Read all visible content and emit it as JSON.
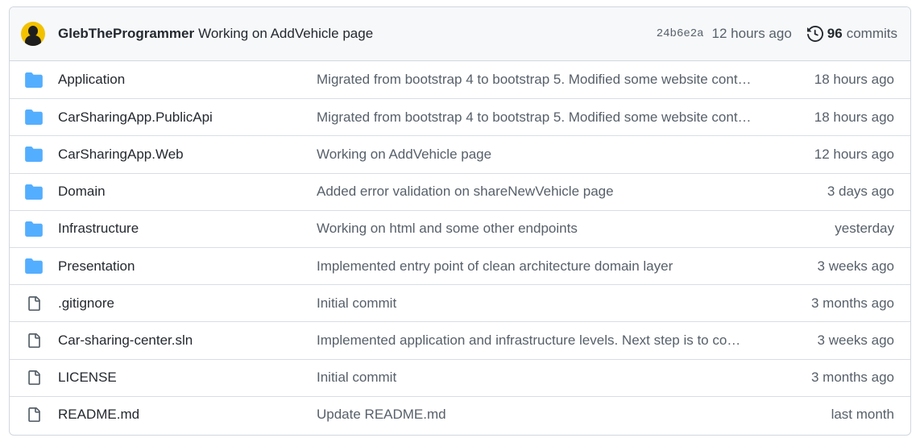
{
  "latest_commit": {
    "author": "GlebTheProgrammer",
    "message": "Working on AddVehicle page",
    "sha": "24b6e2a",
    "time": "12 hours ago",
    "commit_count": "96",
    "commits_label": "commits"
  },
  "files": [
    {
      "type": "folder",
      "icon": "folder-icon",
      "name": "Application",
      "message": "Migrated from bootstrap 4 to bootstrap 5. Modified some website cont…",
      "time": "18 hours ago"
    },
    {
      "type": "folder",
      "icon": "folder-icon",
      "name": "CarSharingApp.PublicApi",
      "message": "Migrated from bootstrap 4 to bootstrap 5. Modified some website cont…",
      "time": "18 hours ago"
    },
    {
      "type": "folder",
      "icon": "folder-icon",
      "name": "CarSharingApp.Web",
      "message": "Working on AddVehicle page",
      "time": "12 hours ago"
    },
    {
      "type": "folder",
      "icon": "folder-icon",
      "name": "Domain",
      "message": "Added error validation on shareNewVehicle page",
      "time": "3 days ago"
    },
    {
      "type": "folder",
      "icon": "folder-icon",
      "name": "Infrastructure",
      "message": "Working on html and some other endpoints",
      "time": "yesterday"
    },
    {
      "type": "folder",
      "icon": "folder-icon",
      "name": "Presentation",
      "message": "Implemented entry point of clean architecture domain layer",
      "time": "3 weeks ago"
    },
    {
      "type": "file",
      "icon": "file-icon",
      "name": ".gitignore",
      "message": "Initial commit",
      "time": "3 months ago"
    },
    {
      "type": "file",
      "icon": "file-icon",
      "name": "Car-sharing-center.sln",
      "message": "Implemented application and infrastructure levels. Next step is to co…",
      "time": "3 weeks ago"
    },
    {
      "type": "file",
      "icon": "file-icon",
      "name": "LICENSE",
      "message": "Initial commit",
      "time": "3 months ago"
    },
    {
      "type": "file",
      "icon": "file-icon",
      "name": "README.md",
      "message": "Update README.md",
      "time": "last month"
    }
  ],
  "colors": {
    "folder": "#54aeff",
    "file": "#57606a",
    "avatar_bg": "#f2c200"
  }
}
